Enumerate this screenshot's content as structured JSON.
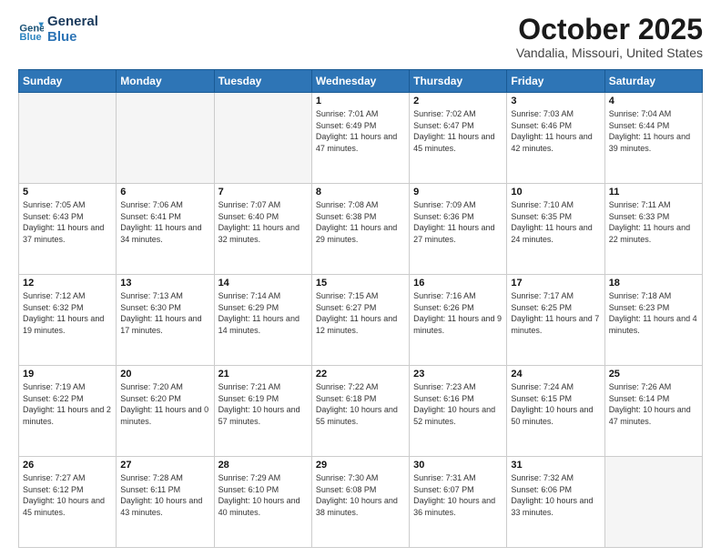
{
  "header": {
    "logo_line1": "General",
    "logo_line2": "Blue",
    "month": "October 2025",
    "location": "Vandalia, Missouri, United States"
  },
  "days_of_week": [
    "Sunday",
    "Monday",
    "Tuesday",
    "Wednesday",
    "Thursday",
    "Friday",
    "Saturday"
  ],
  "weeks": [
    [
      {
        "day": "",
        "empty": true
      },
      {
        "day": "",
        "empty": true
      },
      {
        "day": "",
        "empty": true
      },
      {
        "day": "1",
        "sunrise": "7:01 AM",
        "sunset": "6:49 PM",
        "daylight": "11 hours and 47 minutes."
      },
      {
        "day": "2",
        "sunrise": "7:02 AM",
        "sunset": "6:47 PM",
        "daylight": "11 hours and 45 minutes."
      },
      {
        "day": "3",
        "sunrise": "7:03 AM",
        "sunset": "6:46 PM",
        "daylight": "11 hours and 42 minutes."
      },
      {
        "day": "4",
        "sunrise": "7:04 AM",
        "sunset": "6:44 PM",
        "daylight": "11 hours and 39 minutes."
      }
    ],
    [
      {
        "day": "5",
        "sunrise": "7:05 AM",
        "sunset": "6:43 PM",
        "daylight": "11 hours and 37 minutes."
      },
      {
        "day": "6",
        "sunrise": "7:06 AM",
        "sunset": "6:41 PM",
        "daylight": "11 hours and 34 minutes."
      },
      {
        "day": "7",
        "sunrise": "7:07 AM",
        "sunset": "6:40 PM",
        "daylight": "11 hours and 32 minutes."
      },
      {
        "day": "8",
        "sunrise": "7:08 AM",
        "sunset": "6:38 PM",
        "daylight": "11 hours and 29 minutes."
      },
      {
        "day": "9",
        "sunrise": "7:09 AM",
        "sunset": "6:36 PM",
        "daylight": "11 hours and 27 minutes."
      },
      {
        "day": "10",
        "sunrise": "7:10 AM",
        "sunset": "6:35 PM",
        "daylight": "11 hours and 24 minutes."
      },
      {
        "day": "11",
        "sunrise": "7:11 AM",
        "sunset": "6:33 PM",
        "daylight": "11 hours and 22 minutes."
      }
    ],
    [
      {
        "day": "12",
        "sunrise": "7:12 AM",
        "sunset": "6:32 PM",
        "daylight": "11 hours and 19 minutes."
      },
      {
        "day": "13",
        "sunrise": "7:13 AM",
        "sunset": "6:30 PM",
        "daylight": "11 hours and 17 minutes."
      },
      {
        "day": "14",
        "sunrise": "7:14 AM",
        "sunset": "6:29 PM",
        "daylight": "11 hours and 14 minutes."
      },
      {
        "day": "15",
        "sunrise": "7:15 AM",
        "sunset": "6:27 PM",
        "daylight": "11 hours and 12 minutes."
      },
      {
        "day": "16",
        "sunrise": "7:16 AM",
        "sunset": "6:26 PM",
        "daylight": "11 hours and 9 minutes."
      },
      {
        "day": "17",
        "sunrise": "7:17 AM",
        "sunset": "6:25 PM",
        "daylight": "11 hours and 7 minutes."
      },
      {
        "day": "18",
        "sunrise": "7:18 AM",
        "sunset": "6:23 PM",
        "daylight": "11 hours and 4 minutes."
      }
    ],
    [
      {
        "day": "19",
        "sunrise": "7:19 AM",
        "sunset": "6:22 PM",
        "daylight": "11 hours and 2 minutes."
      },
      {
        "day": "20",
        "sunrise": "7:20 AM",
        "sunset": "6:20 PM",
        "daylight": "11 hours and 0 minutes."
      },
      {
        "day": "21",
        "sunrise": "7:21 AM",
        "sunset": "6:19 PM",
        "daylight": "10 hours and 57 minutes."
      },
      {
        "day": "22",
        "sunrise": "7:22 AM",
        "sunset": "6:18 PM",
        "daylight": "10 hours and 55 minutes."
      },
      {
        "day": "23",
        "sunrise": "7:23 AM",
        "sunset": "6:16 PM",
        "daylight": "10 hours and 52 minutes."
      },
      {
        "day": "24",
        "sunrise": "7:24 AM",
        "sunset": "6:15 PM",
        "daylight": "10 hours and 50 minutes."
      },
      {
        "day": "25",
        "sunrise": "7:26 AM",
        "sunset": "6:14 PM",
        "daylight": "10 hours and 47 minutes."
      }
    ],
    [
      {
        "day": "26",
        "sunrise": "7:27 AM",
        "sunset": "6:12 PM",
        "daylight": "10 hours and 45 minutes."
      },
      {
        "day": "27",
        "sunrise": "7:28 AM",
        "sunset": "6:11 PM",
        "daylight": "10 hours and 43 minutes."
      },
      {
        "day": "28",
        "sunrise": "7:29 AM",
        "sunset": "6:10 PM",
        "daylight": "10 hours and 40 minutes."
      },
      {
        "day": "29",
        "sunrise": "7:30 AM",
        "sunset": "6:08 PM",
        "daylight": "10 hours and 38 minutes."
      },
      {
        "day": "30",
        "sunrise": "7:31 AM",
        "sunset": "6:07 PM",
        "daylight": "10 hours and 36 minutes."
      },
      {
        "day": "31",
        "sunrise": "7:32 AM",
        "sunset": "6:06 PM",
        "daylight": "10 hours and 33 minutes."
      },
      {
        "day": "",
        "empty": true
      }
    ]
  ]
}
